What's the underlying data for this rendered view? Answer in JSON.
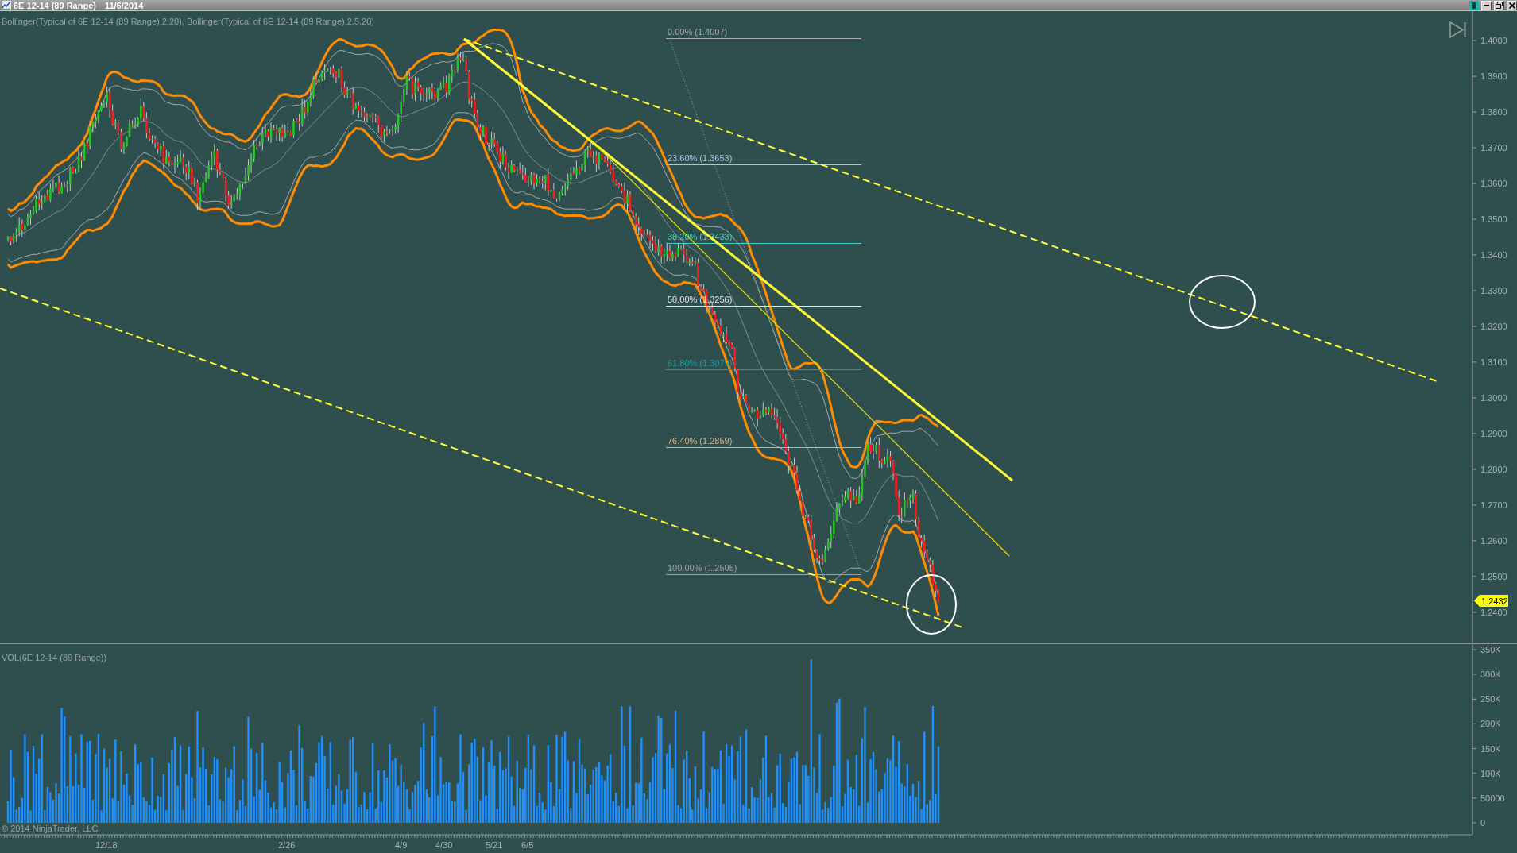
{
  "window": {
    "title": "6E 12-14 (89 Range)",
    "date": "11/6/2014"
  },
  "price_panel": {
    "indicator_label": "Bollinger(Typical of 6E 12-14 (89 Range),2,20), Bollinger(Typical of 6E 12-14 (89 Range),2.5,20)",
    "axis_labels": [
      "1.4000",
      "1.3900",
      "1.3800",
      "1.3700",
      "1.3600",
      "1.3500",
      "1.3400",
      "1.3300",
      "1.3200",
      "1.3100",
      "1.3000",
      "1.2900",
      "1.2800",
      "1.2700",
      "1.2600",
      "1.2500",
      "1.2400"
    ],
    "last_price": "1.2432",
    "fibonacci_levels": [
      {
        "label": "0.00% (1.4007)",
        "color": "#a9a9a9"
      },
      {
        "label": "23.60% (1.3653)",
        "color": "#b0c4de"
      },
      {
        "label": "38.20% (1.3433)",
        "color": "#48d1cc"
      },
      {
        "label": "50.00% (1.3256)",
        "color": "#e6e6e6"
      },
      {
        "label": "61.80% (1.3079)",
        "color": "#1e9e9e"
      },
      {
        "label": "76.40% (1.2859)",
        "color": "#d2b48c"
      },
      {
        "label": "100.00% (1.2505)",
        "color": "#a0a0a0"
      }
    ]
  },
  "volume_panel": {
    "label": "VOL(6E 12-14 (89 Range))",
    "axis_labels": [
      "350K",
      "300K",
      "250K",
      "200K",
      "150K",
      "100K",
      "50000",
      "0"
    ]
  },
  "time_axis": {
    "labels": [
      "12/18",
      "2/26",
      "4/9",
      "4/30",
      "5/21",
      "6/5"
    ]
  },
  "copyright": "© 2014 NinjaTrader, LLC"
}
